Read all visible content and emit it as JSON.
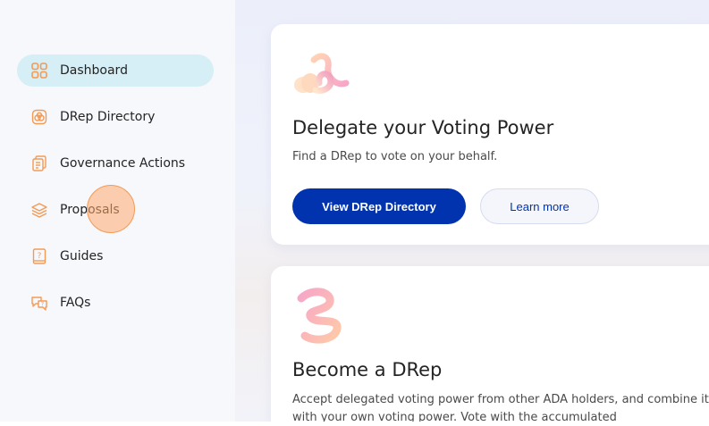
{
  "sidebar": {
    "items": [
      {
        "label": "Dashboard",
        "icon": "dashboard-icon",
        "active": true
      },
      {
        "label": "DRep Directory",
        "icon": "drep-directory-icon",
        "active": false
      },
      {
        "label": "Governance Actions",
        "icon": "governance-actions-icon",
        "active": false
      },
      {
        "label": "Proposals",
        "icon": "proposals-icon",
        "active": false
      },
      {
        "label": "Guides",
        "icon": "guides-icon",
        "active": false
      },
      {
        "label": "FAQs",
        "icon": "faqs-icon",
        "active": false
      }
    ]
  },
  "cards": [
    {
      "title": "Delegate your Voting Power",
      "text": "Find a DRep to vote on your behalf.",
      "primary_button": "View DRep Directory",
      "secondary_button": "Learn more"
    },
    {
      "title": "Become a DRep",
      "text": "Accept delegated voting power from other ADA holders, and combine it with your own voting power. Vote with the accumulated"
    }
  ],
  "colors": {
    "accent": "#0033ad",
    "active_nav_bg": "#d6eef5",
    "icon_orange": "#f39a55"
  }
}
